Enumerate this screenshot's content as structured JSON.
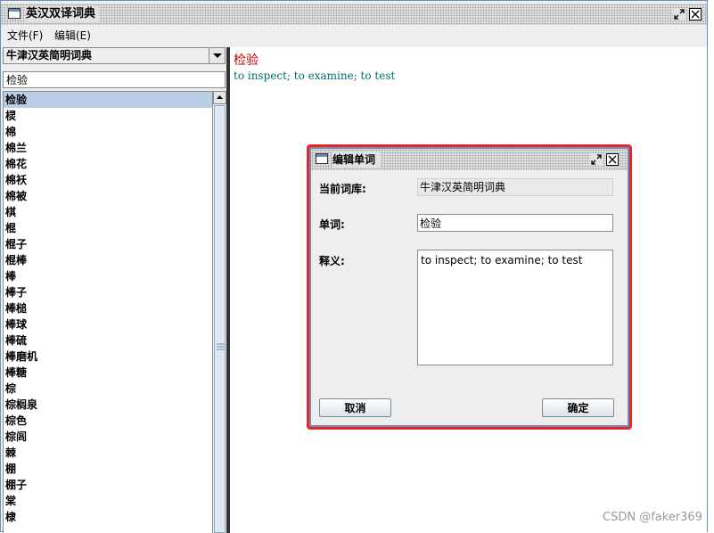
{
  "window": {
    "title": "英汉双译词典",
    "icon": "app-window-icon",
    "controls": [
      "restore-icon",
      "close-icon"
    ]
  },
  "menubar": {
    "file": "文件(F)",
    "edit": "编辑(E)"
  },
  "left_panel": {
    "dictionary_selected": "牛津汉英简明词典",
    "search_value": "检验",
    "list_items": [
      "检验",
      "棂",
      "棉",
      "棉兰",
      "棉花",
      "棉袄",
      "棉被",
      "棋",
      "棍",
      "棍子",
      "棍棒",
      "棒",
      "棒子",
      "棒槌",
      "棒球",
      "棒硫",
      "棒磨机",
      "棒糖",
      "棕",
      "棕榈泉",
      "棕色",
      "棕闾",
      "棘",
      "棚",
      "棚子",
      "棠",
      "棣"
    ],
    "selected_index": 0
  },
  "content": {
    "headword": "检验",
    "definition": "to inspect; to examine; to test"
  },
  "dialog": {
    "title": "编辑单词",
    "current_dict_label": "当前词库:",
    "current_dict_value": "牛津汉英简明词典",
    "word_label": "单词:",
    "word_value": "检验",
    "definition_label": "释义:",
    "definition_value": "to inspect; to examine; to test",
    "cancel_label": "取消",
    "ok_label": "确定",
    "highlight_color": "#e8232a"
  },
  "watermark": "CSDN @faker369"
}
